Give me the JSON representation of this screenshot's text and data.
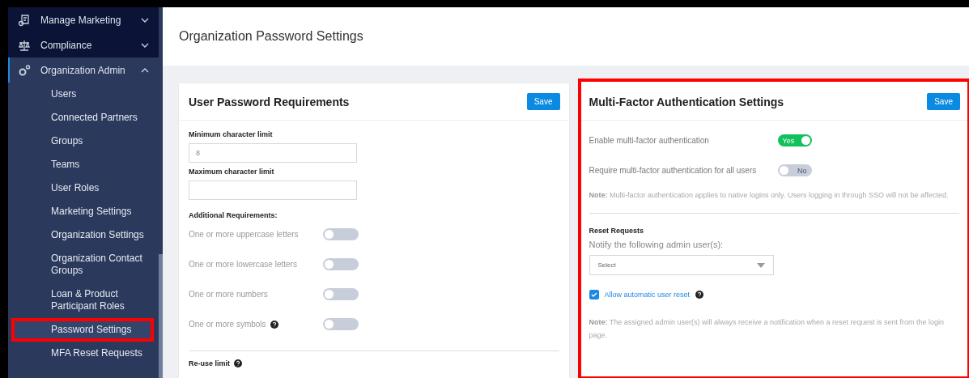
{
  "sidebar": {
    "items": [
      {
        "label": "Manage Marketing",
        "expanded": false,
        "selected": false
      },
      {
        "label": "Compliance",
        "expanded": false,
        "selected": false
      },
      {
        "label": "Organization Admin",
        "expanded": true,
        "selected": false,
        "children": [
          {
            "label": "Users",
            "selected": false,
            "highlighted": false
          },
          {
            "label": "Connected Partners",
            "selected": false,
            "highlighted": false
          },
          {
            "label": "Groups",
            "selected": false,
            "highlighted": false
          },
          {
            "label": "Teams",
            "selected": false,
            "highlighted": false
          },
          {
            "label": "User Roles",
            "selected": false,
            "highlighted": false
          },
          {
            "label": "Marketing Settings",
            "selected": false,
            "highlighted": false
          },
          {
            "label": "Organization Settings",
            "selected": false,
            "highlighted": false
          },
          {
            "label": "Organization Contact Groups",
            "selected": false,
            "highlighted": false
          },
          {
            "label": "Loan & Product Participant Roles",
            "selected": false,
            "highlighted": false
          },
          {
            "label": "Password Settings",
            "selected": true,
            "highlighted": true
          },
          {
            "label": "MFA Reset Requests",
            "selected": false,
            "highlighted": false
          }
        ]
      }
    ]
  },
  "page_title": "Organization Password Settings",
  "password_panel": {
    "title": "User Password Requirements",
    "save": "Save",
    "highlighted": false,
    "fields": [
      {
        "label": "Minimum character limit",
        "value": "8"
      },
      {
        "label": "Maximum character limit"
      }
    ],
    "additional_heading": "Additional Requirements:",
    "toggles": [
      {
        "label": "One or more uppercase letters",
        "on": false,
        "help": false
      },
      {
        "label": "One or more lowercase letters",
        "on": false,
        "help": false
      },
      {
        "label": "One or more numbers",
        "on": false,
        "help": false
      },
      {
        "label": "One or more symbols",
        "on": false,
        "help": true
      }
    ],
    "reuse_label": "Re-use limit"
  },
  "mfa_panel": {
    "title": "Multi-Factor Authentication Settings",
    "save": "Save",
    "highlighted": true,
    "toggles": [
      {
        "label": "Enable multi-factor authentication",
        "on": true,
        "text": "Yes"
      },
      {
        "label": "Require multi-factor authentication for all users",
        "on": false,
        "text": "No"
      }
    ],
    "note": "**Note:** Multi-factor authentication applies to native logins only. Users logging in through SSO will not be affected.",
    "reset_heading": "Reset Requests",
    "notify_label": "Notify the following admin user(s):",
    "select_placeholder": "Select",
    "auto_reset": {
      "label": "Allow automatic user reset",
      "checked": true
    },
    "reset_note": "**Note:** The assigned admin user(s) will always receive a notification when a reset request is sent from the login page."
  }
}
